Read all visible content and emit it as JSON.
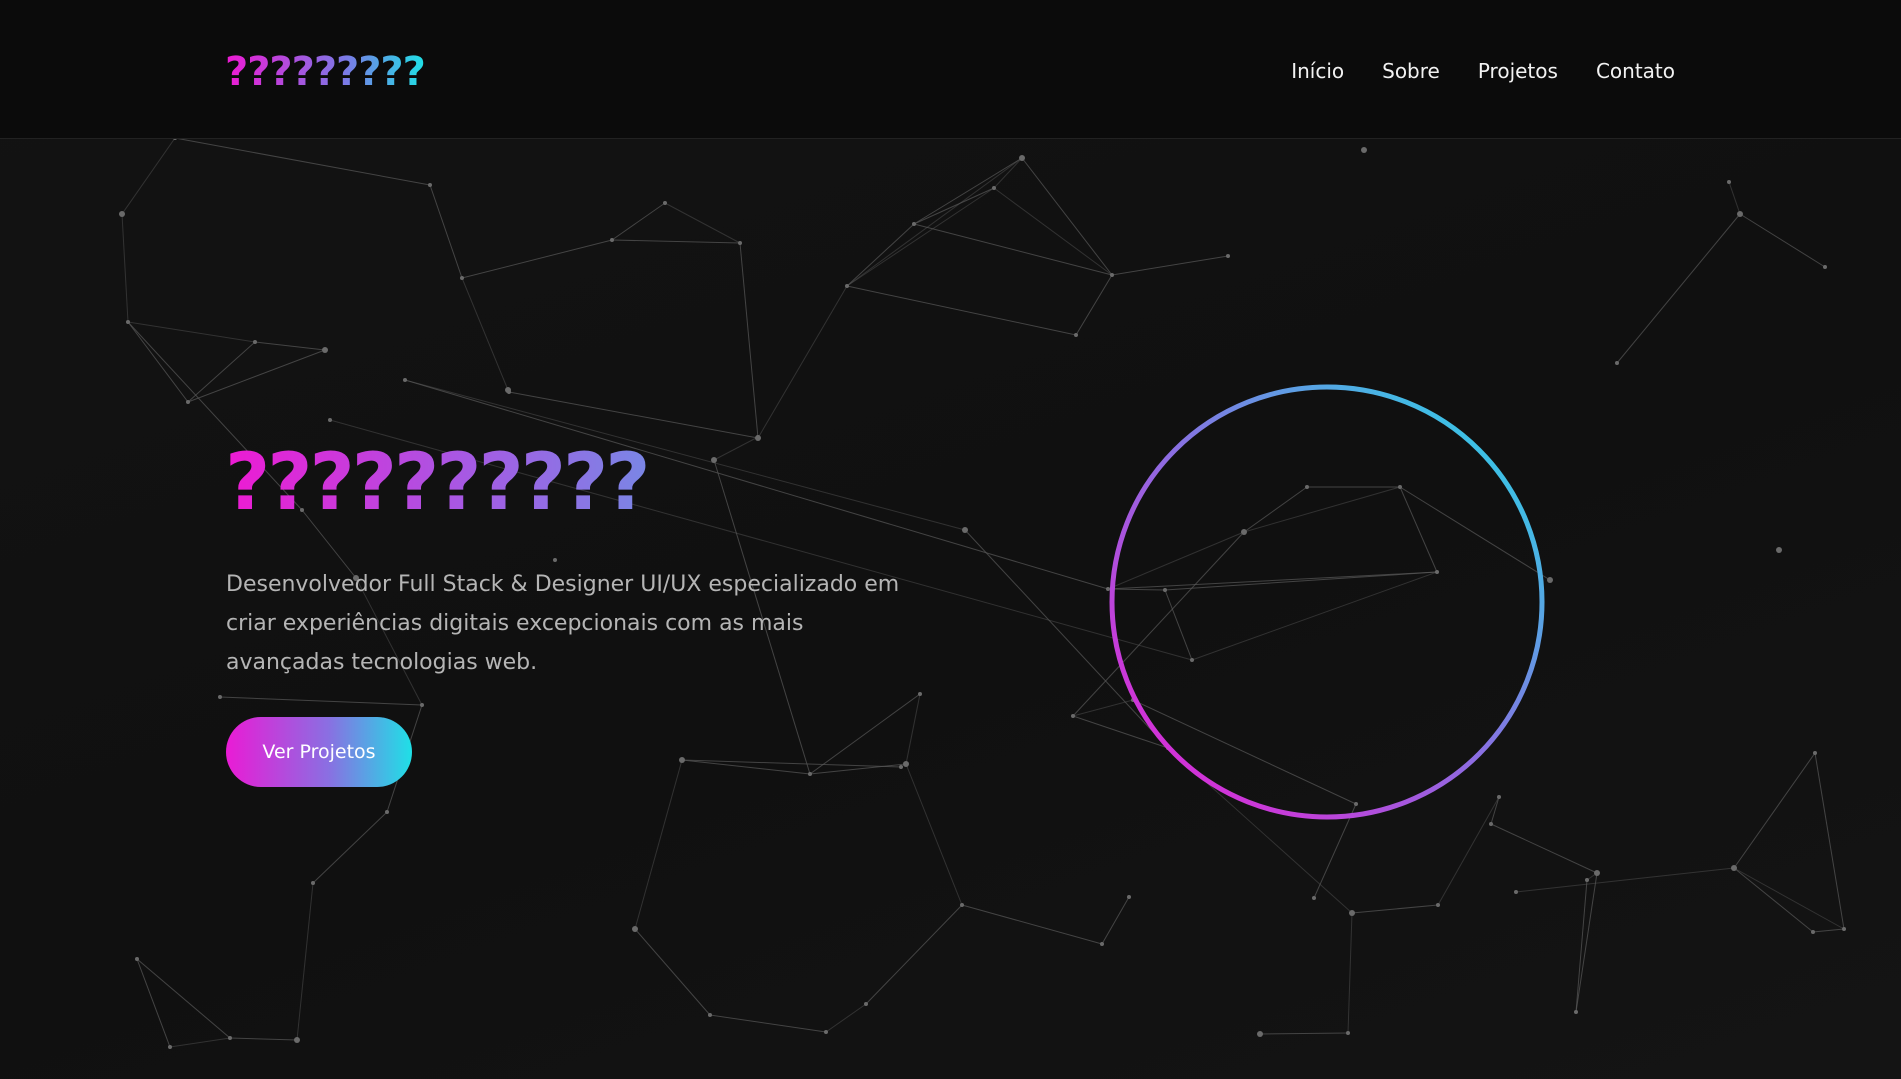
{
  "nav": {
    "logo": "?????????",
    "links": [
      "Início",
      "Sobre",
      "Projetos",
      "Contato"
    ]
  },
  "hero": {
    "title": "??????????",
    "description": "Desenvolvedor Full Stack & Designer UI/UX especializado em criar experiências digitais excepcionais com as mais avançadas tecnologias web.",
    "cta_label": "Ver Projetos"
  },
  "colors": {
    "background": "#111111",
    "navbar": "#0b0b0b",
    "accent_magenta": "#ee1ad3",
    "accent_purple": "#8a6fe2",
    "accent_cyan": "#1fe0e6",
    "network_lines": "#5a5a5a"
  }
}
